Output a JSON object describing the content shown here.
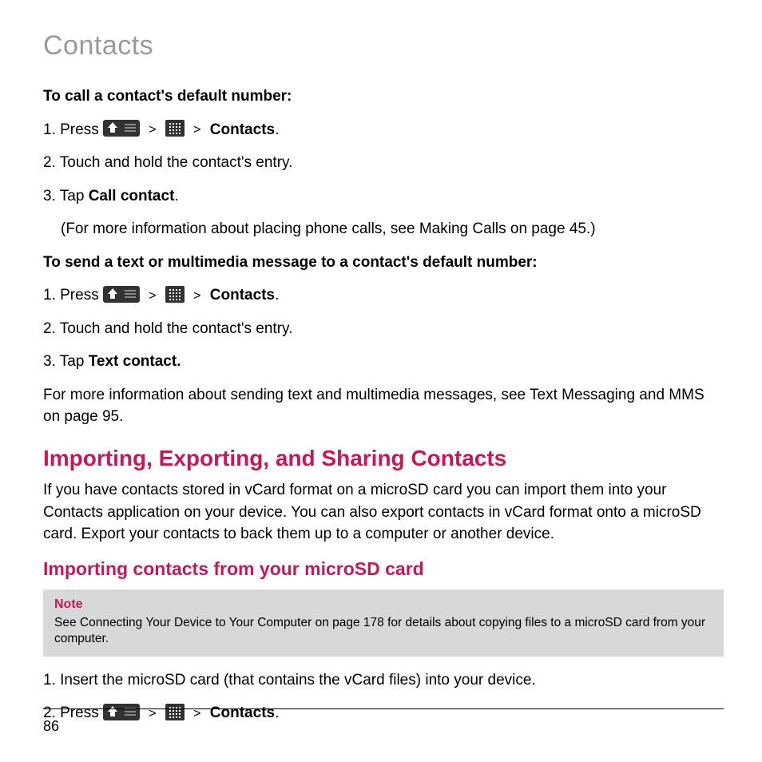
{
  "chapter": "Contacts",
  "page_number": "86",
  "section1": {
    "title1": "To call a contact's default number:",
    "step1_prefix": "1. Press ",
    "breadcrumb_sep": ">",
    "breadcrumb_end": "Contacts",
    "breadcrumb_period": ".",
    "step2": "2. Touch and hold the contact's entry.",
    "step3_prefix": "3. Tap ",
    "step3_bold": "Call contact",
    "step3_suffix": ".",
    "step3_note": "(For more information about placing phone calls, see Making Calls on page 45.)",
    "title2": "To send a text or multimedia message to a contact's default number:",
    "b_step1_prefix": "1. Press ",
    "b_step2": "2. Touch and hold the contact's entry.",
    "b_step3_prefix": "3. Tap ",
    "b_step3_bold": "Text contact.",
    "b_after": "For more information about sending text and multimedia messages, see Text Messaging and MMS on page 95."
  },
  "section2": {
    "heading": "Importing, Exporting, and Sharing Contacts",
    "para": "If you have contacts stored in vCard format on a microSD card you can import them into your Contacts application on your device. You can also export contacts in vCard format onto a microSD card. Export your contacts to back them up to a computer or another device.",
    "subheading": "Importing contacts from your microSD card",
    "note_title": "Note",
    "note_body": "See Connecting Your Device to Your Computer on page 178 for details about copying files to a microSD card from your computer.",
    "step1": "1. Insert the microSD card (that contains the vCard files) into your device.",
    "step2_prefix": "2. Press "
  }
}
